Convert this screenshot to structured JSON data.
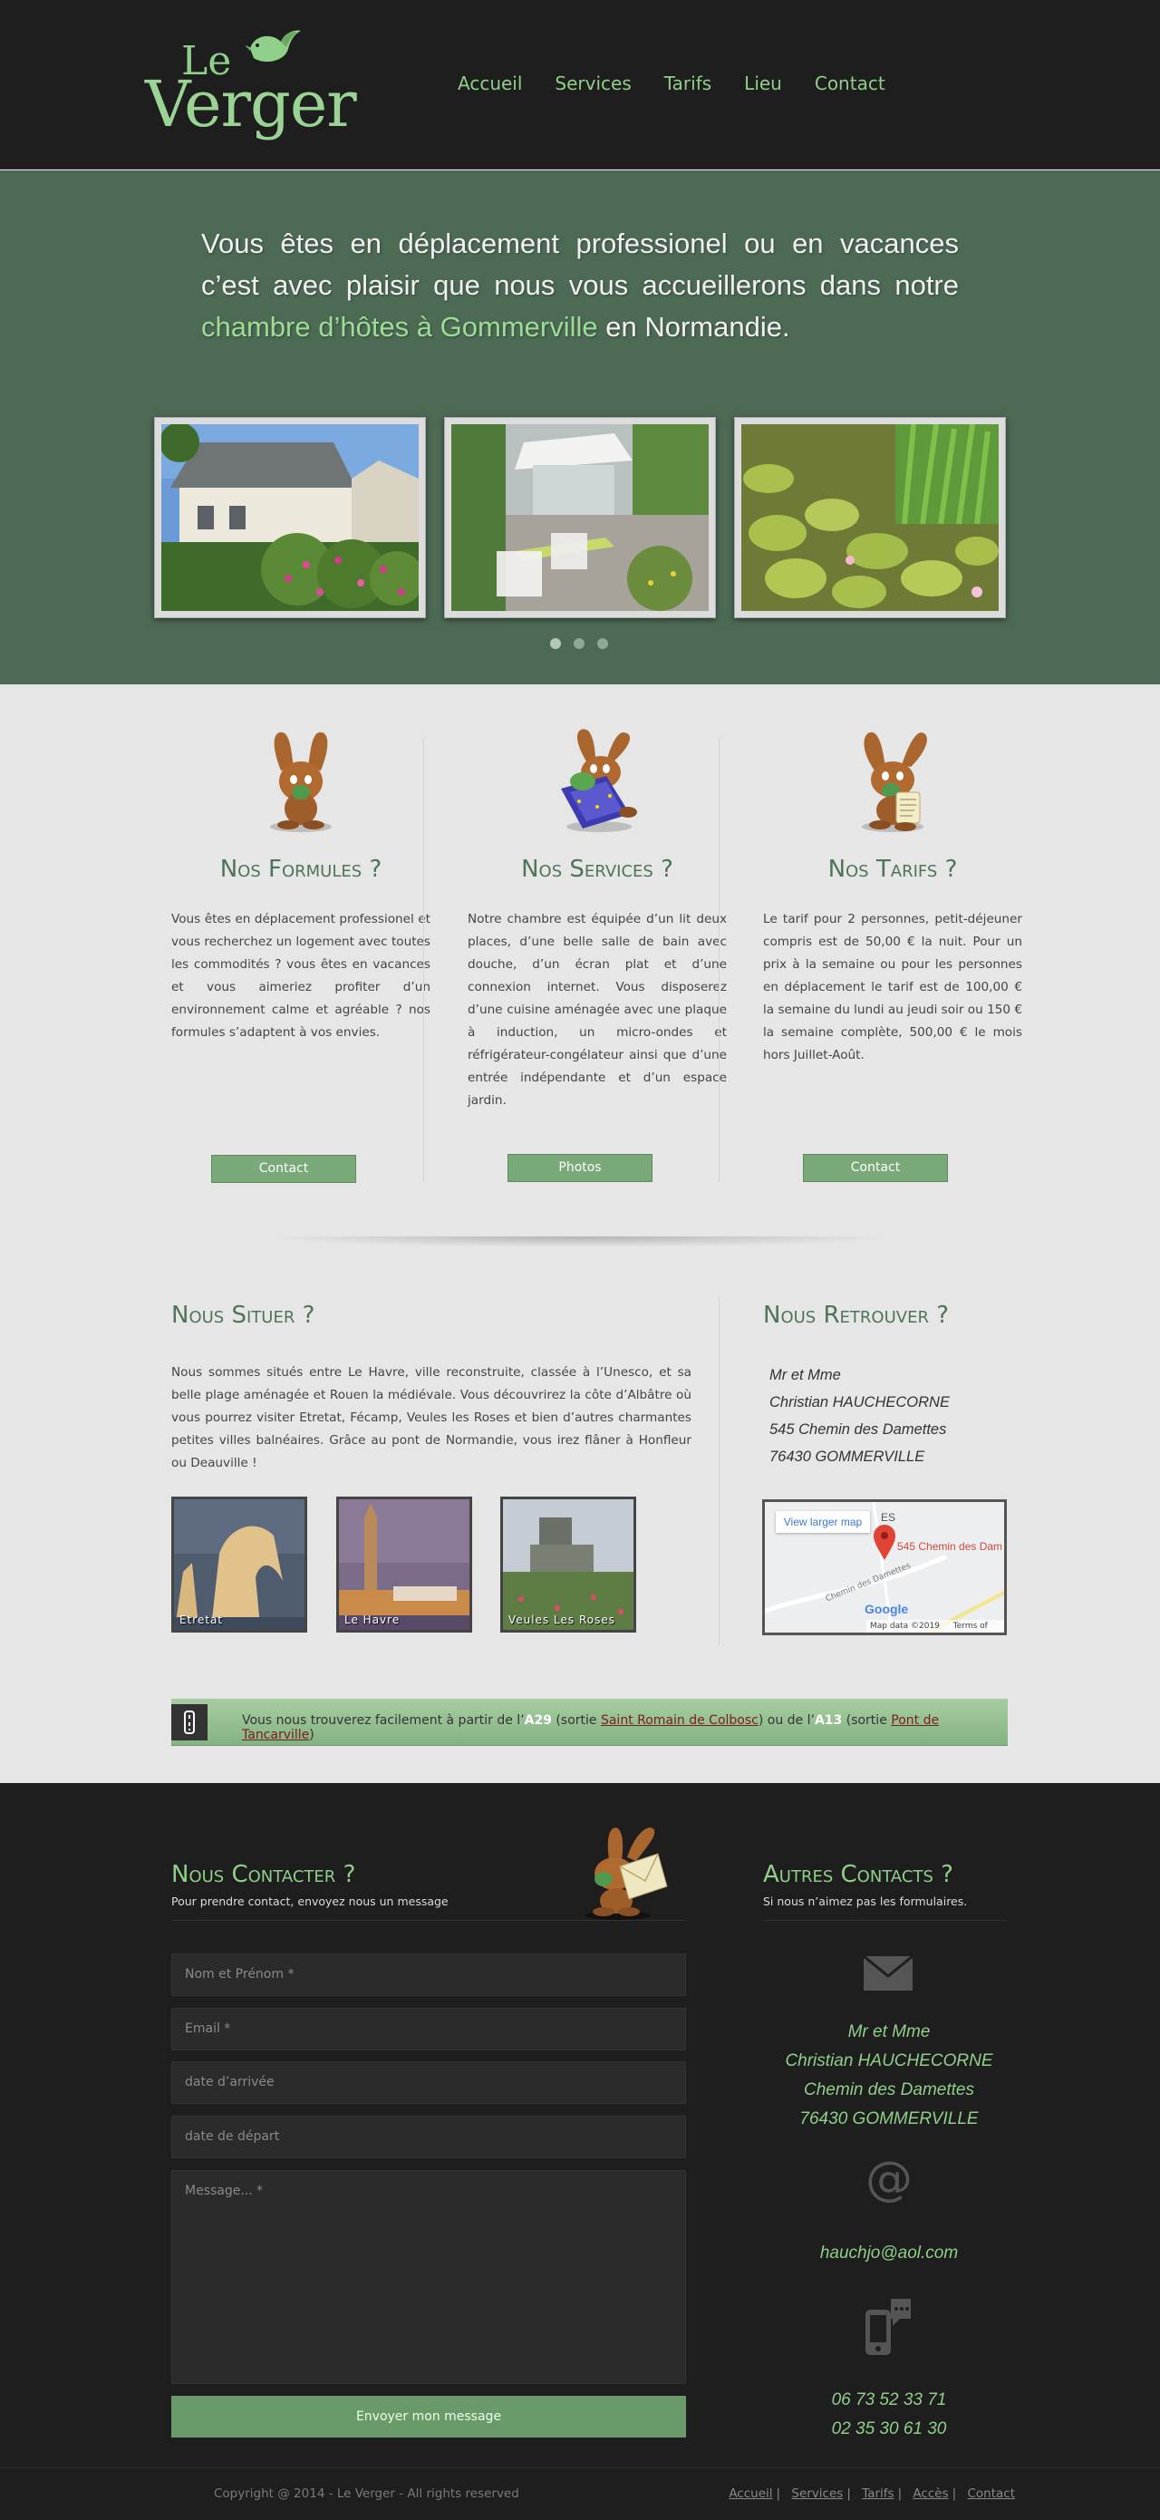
{
  "header": {
    "logo_top": "Le",
    "logo_bottom": "Verger",
    "nav": [
      "Accueil",
      "Services",
      "Tarifs",
      "Lieu",
      "Contact"
    ]
  },
  "hero": {
    "text_before": "Vous êtes en déplacement professionel ou en vacances c’est avec plaisir que nous vous accueillerons dans notre ",
    "text_highlight": "chambre d’hôtes à Gommerville",
    "text_after": " en Normandie."
  },
  "columns": [
    {
      "title": "Nos Formules ?",
      "text": "Vous êtes en déplacement professionel et vous recherchez un logement avec toutes les commodités ? vous êtes en vacances et vous aimeriez profiter d’un environnement calme et agréable ? nos formules s’adaptent à vos envies.",
      "button": "Contact"
    },
    {
      "title": "Nos Services ?",
      "text": "Notre chambre est équipée d’un lit deux places, d’une belle salle de bain avec douche, d’un écran plat et d’une connexion internet. Vous disposerez d’une cuisine aménagée avec une plaque à induction, un micro-ondes et réfrigérateur-congélateur ainsi que d’une entrée indépendante et d’un espace jardin.",
      "button": "Photos"
    },
    {
      "title": "Nos Tarifs ?",
      "text": "Le tarif pour 2 personnes, petit-déjeuner compris est de 50,00 € la nuit. Pour un prix à la semaine ou pour les personnes en déplacement le tarif est de 100,00 € la semaine du lundi au jeudi soir ou 150 € la semaine complète, 500,00 € le mois hors Juillet-Août.",
      "button": "Contact"
    }
  ],
  "situer": {
    "title": "Nous Situer ?",
    "text": "Nous sommes situés entre Le Havre, ville reconstruite, classée à l’Unesco, et sa belle plage aménagée et Rouen la médiévale. Vous découvrirez la côte d’Albâtre où vous pourrez visiter Etretat, Fécamp, Veules les Roses et bien d’autres charmantes petites villes balnéaires. Grâce au pont de Normandie, vous irez flâner à Honfleur ou Deauville !",
    "thumbs": [
      "Etretat",
      "Le Havre",
      "Veules Les Roses"
    ]
  },
  "retrouver": {
    "title": "Nous Retrouver ?",
    "address": [
      "Mr et Mme",
      "Christian HAUCHECORNE",
      "545 Chemin des Damettes",
      "76430 GOMMERVILLE"
    ],
    "map_button": "View larger map",
    "map_marker_label": "545 Chemin des Dam",
    "map_road": "Chemin des Damettes",
    "map_pin_letter": "ES",
    "map_google": "Google",
    "map_data": "Map data ©2019",
    "map_terms": "Terms of Use"
  },
  "banner": {
    "prefix": "Vous nous trouverez facilement à partir de l’",
    "road1": "A29",
    "exit1_pre": " (sortie ",
    "exit1": "Saint Romain de Colbosc",
    "mid": ") ou de l’",
    "road2": "A13",
    "exit2_pre": " (sortie ",
    "exit2": "Pont de Tancarville",
    "suffix": ")"
  },
  "contact": {
    "title": "Nous Contacter ?",
    "subtitle": "Pour prendre contact, envoyez nous un message",
    "fields": [
      "Nom et Prénom *",
      "Email *",
      "date d’arrivée",
      "date de départ"
    ],
    "message_placeholder": "Message... *",
    "send": "Envoyer mon message"
  },
  "autres": {
    "title": "Autres Contacts ?",
    "subtitle": "Si nous n’aimez pas les formulaires.",
    "address": [
      "Mr et Mme",
      "Christian HAUCHECORNE",
      "Chemin des Damettes",
      "76430 GOMMERVILLE"
    ],
    "email": "hauchjo@aol.com",
    "phones": [
      "06 73 52 33 71",
      "02 35 30 61 30"
    ]
  },
  "footer": {
    "copyright": "Copyright @ 2014 - Le Verger - All rights reserved",
    "links": [
      "Accueil",
      "Services",
      "Tarifs",
      "Accès",
      "Contact"
    ]
  },
  "colors": {
    "green_text": "#8fcf89",
    "title_green": "#4f7458",
    "hero_bg": "#4d6a55",
    "dark_bg": "#1e1e1e",
    "button": "#79a879"
  }
}
